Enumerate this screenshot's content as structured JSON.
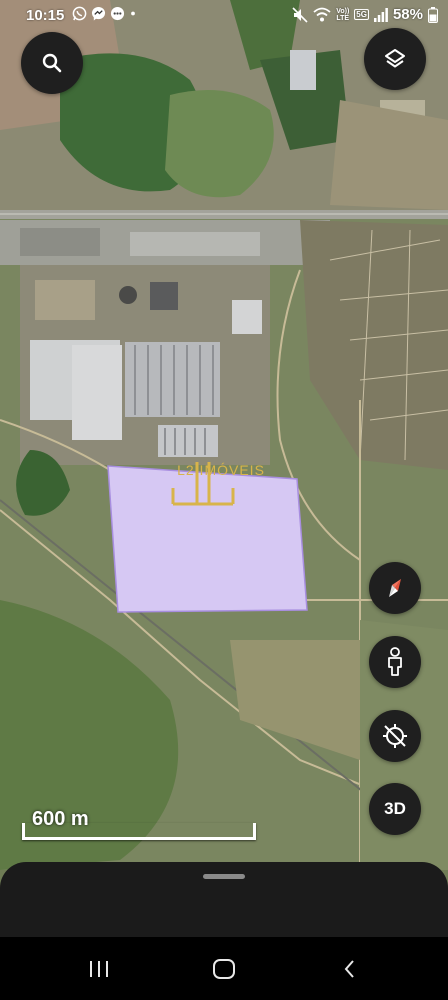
{
  "status_bar": {
    "time": "10:15",
    "battery_percent": "58%",
    "network": "LTE",
    "network_prefix": "Vo))",
    "network_gen": "5G",
    "left_icons": [
      "whatsapp-icon",
      "messenger-icon",
      "chat-icon",
      "dot-icon"
    ],
    "right_icons": [
      "mute-icon",
      "wifi-icon",
      "signal-icon",
      "battery-icon"
    ]
  },
  "map": {
    "search_icon": "search-icon",
    "layers_icon": "layers-icon",
    "controls": {
      "compass": "compass-icon",
      "street_view": "pegman-icon",
      "location": "location-off-icon",
      "view_3d_label": "3D"
    },
    "watermark_text": "L2 IMÓVEIS",
    "scale_label": "600 m",
    "polygon_fill": "#d6c8f3",
    "polygon_stroke": "#a88ee0"
  },
  "nav_bar": {
    "recent_apps_icon": "recent-apps-icon",
    "home_icon": "home-icon",
    "back_icon": "back-icon"
  }
}
